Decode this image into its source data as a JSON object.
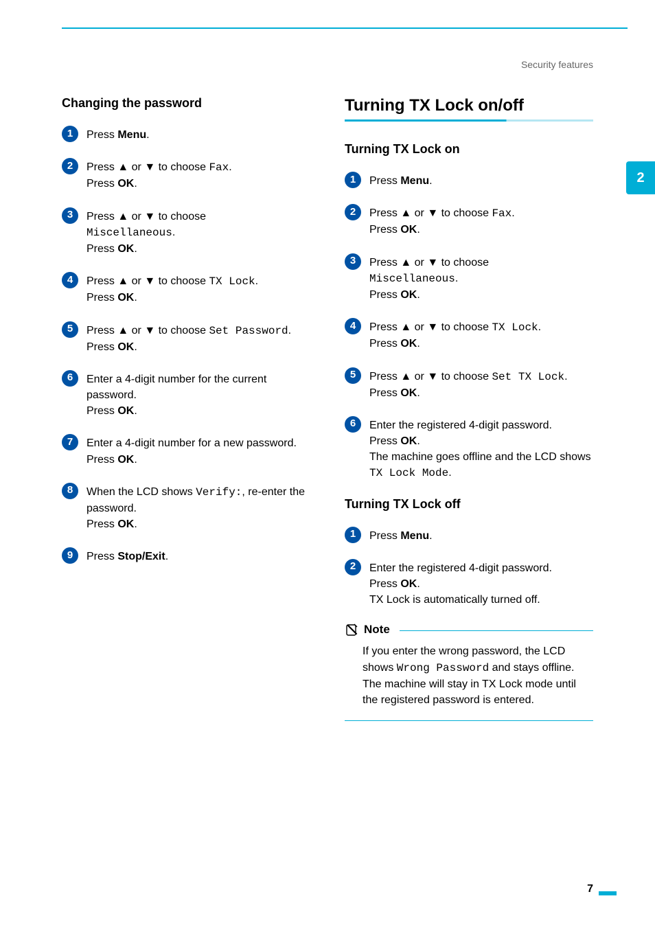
{
  "breadcrumb": "Security features",
  "page_tab": "2",
  "page_number": "7",
  "left": {
    "heading": "Changing the password",
    "steps": [
      {
        "n": "1",
        "color": "#0052a4",
        "parts": [
          {
            "t": "Press ",
            "b": false
          },
          {
            "t": "Menu",
            "b": true
          },
          {
            "t": ".",
            "b": false
          }
        ]
      },
      {
        "n": "2",
        "color": "#0052a4",
        "parts": [
          {
            "t": "Press ",
            "b": false
          },
          {
            "t": "a",
            "arrow": "up"
          },
          {
            "t": " or ",
            "b": false
          },
          {
            "t": "b",
            "arrow": "down"
          },
          {
            "t": " to choose ",
            "b": false
          },
          {
            "t": "Fax",
            "mono": true
          },
          {
            "t": ".",
            "b": false
          },
          {
            "br": true
          },
          {
            "t": "Press ",
            "b": false
          },
          {
            "t": "OK",
            "b": true
          },
          {
            "t": ".",
            "b": false
          }
        ]
      },
      {
        "n": "3",
        "color": "#0052a4",
        "parts": [
          {
            "t": "Press ",
            "b": false
          },
          {
            "t": "a",
            "arrow": "up"
          },
          {
            "t": " or ",
            "b": false
          },
          {
            "t": "b",
            "arrow": "down"
          },
          {
            "t": " to choose ",
            "b": false
          },
          {
            "br": true
          },
          {
            "t": "Miscellaneous",
            "mono": true
          },
          {
            "t": ".",
            "b": false
          },
          {
            "br": true
          },
          {
            "t": "Press ",
            "b": false
          },
          {
            "t": "OK",
            "b": true
          },
          {
            "t": ".",
            "b": false
          }
        ]
      },
      {
        "n": "4",
        "color": "#0052a4",
        "parts": [
          {
            "t": "Press ",
            "b": false
          },
          {
            "t": "a",
            "arrow": "up"
          },
          {
            "t": " or ",
            "b": false
          },
          {
            "t": "b",
            "arrow": "down"
          },
          {
            "t": " to choose ",
            "b": false
          },
          {
            "t": "TX Lock",
            "mono": true
          },
          {
            "t": ".",
            "b": false
          },
          {
            "br": true
          },
          {
            "t": "Press ",
            "b": false
          },
          {
            "t": "OK",
            "b": true
          },
          {
            "t": ".",
            "b": false
          }
        ]
      },
      {
        "n": "5",
        "color": "#0052a4",
        "parts": [
          {
            "t": "Press ",
            "b": false
          },
          {
            "t": "a",
            "arrow": "up"
          },
          {
            "t": " or ",
            "b": false
          },
          {
            "t": "b",
            "arrow": "down"
          },
          {
            "t": " to choose ",
            "b": false
          },
          {
            "t": "Set Password",
            "mono": true
          },
          {
            "t": ".",
            "b": false
          },
          {
            "br": true
          },
          {
            "t": "Press ",
            "b": false
          },
          {
            "t": "OK",
            "b": true
          },
          {
            "t": ".",
            "b": false
          }
        ]
      },
      {
        "n": "6",
        "color": "#0052a4",
        "parts": [
          {
            "t": "Enter a 4-digit number for the current password.",
            "b": false
          },
          {
            "br": true
          },
          {
            "t": "Press ",
            "b": false
          },
          {
            "t": "OK",
            "b": true
          },
          {
            "t": ".",
            "b": false
          }
        ]
      },
      {
        "n": "7",
        "color": "#0052a4",
        "parts": [
          {
            "t": "Enter a 4-digit number for a new password.",
            "b": false
          },
          {
            "br": true
          },
          {
            "t": "Press ",
            "b": false
          },
          {
            "t": "OK",
            "b": true
          },
          {
            "t": ".",
            "b": false
          }
        ]
      },
      {
        "n": "8",
        "color": "#0052a4",
        "parts": [
          {
            "t": "When the LCD shows ",
            "b": false
          },
          {
            "t": "Verify:",
            "mono": true
          },
          {
            "t": ", re-enter the password.",
            "b": false
          },
          {
            "br": true
          },
          {
            "t": "Press ",
            "b": false
          },
          {
            "t": "OK",
            "b": true
          },
          {
            "t": ".",
            "b": false
          }
        ]
      },
      {
        "n": "9",
        "color": "#0052a4",
        "parts": [
          {
            "t": "Press ",
            "b": false
          },
          {
            "t": "Stop/Exit",
            "b": true
          },
          {
            "t": ".",
            "b": false
          }
        ]
      }
    ]
  },
  "right": {
    "title": "Turning TX Lock on/off",
    "sectionA": {
      "heading": "Turning TX Lock on",
      "steps": [
        {
          "n": "1",
          "color": "#0052a4",
          "parts": [
            {
              "t": "Press ",
              "b": false
            },
            {
              "t": "Menu",
              "b": true
            },
            {
              "t": ".",
              "b": false
            }
          ]
        },
        {
          "n": "2",
          "color": "#0052a4",
          "parts": [
            {
              "t": "Press ",
              "b": false
            },
            {
              "t": "a",
              "arrow": "up"
            },
            {
              "t": " or ",
              "b": false
            },
            {
              "t": "b",
              "arrow": "down"
            },
            {
              "t": " to choose ",
              "b": false
            },
            {
              "t": "Fax",
              "mono": true
            },
            {
              "t": ".",
              "b": false
            },
            {
              "br": true
            },
            {
              "t": "Press ",
              "b": false
            },
            {
              "t": "OK",
              "b": true
            },
            {
              "t": ".",
              "b": false
            }
          ]
        },
        {
          "n": "3",
          "color": "#0052a4",
          "parts": [
            {
              "t": "Press ",
              "b": false
            },
            {
              "t": "a",
              "arrow": "up"
            },
            {
              "t": " or ",
              "b": false
            },
            {
              "t": "b",
              "arrow": "down"
            },
            {
              "t": " to choose ",
              "b": false
            },
            {
              "br": true
            },
            {
              "t": "Miscellaneous",
              "mono": true
            },
            {
              "t": ".",
              "b": false
            },
            {
              "br": true
            },
            {
              "t": "Press ",
              "b": false
            },
            {
              "t": "OK",
              "b": true
            },
            {
              "t": ".",
              "b": false
            }
          ]
        },
        {
          "n": "4",
          "color": "#0052a4",
          "parts": [
            {
              "t": "Press ",
              "b": false
            },
            {
              "t": "a",
              "arrow": "up"
            },
            {
              "t": " or ",
              "b": false
            },
            {
              "t": "b",
              "arrow": "down"
            },
            {
              "t": " to choose ",
              "b": false
            },
            {
              "t": "TX Lock",
              "mono": true
            },
            {
              "t": ".",
              "b": false
            },
            {
              "br": true
            },
            {
              "t": "Press ",
              "b": false
            },
            {
              "t": "OK",
              "b": true
            },
            {
              "t": ".",
              "b": false
            }
          ]
        },
        {
          "n": "5",
          "color": "#0052a4",
          "parts": [
            {
              "t": "Press ",
              "b": false
            },
            {
              "t": "a",
              "arrow": "up"
            },
            {
              "t": " or ",
              "b": false
            },
            {
              "t": "b",
              "arrow": "down"
            },
            {
              "t": " to choose ",
              "b": false
            },
            {
              "t": "Set TX Lock",
              "mono": true
            },
            {
              "t": ".",
              "b": false
            },
            {
              "br": true
            },
            {
              "t": "Press ",
              "b": false
            },
            {
              "t": "OK",
              "b": true
            },
            {
              "t": ".",
              "b": false
            }
          ]
        },
        {
          "n": "6",
          "color": "#0052a4",
          "parts": [
            {
              "t": "Enter the registered 4-digit password.",
              "b": false
            },
            {
              "br": true
            },
            {
              "t": "Press ",
              "b": false
            },
            {
              "t": "OK",
              "b": true
            },
            {
              "t": ".",
              "b": false
            },
            {
              "br": true
            },
            {
              "t": "The machine goes offline and the LCD shows ",
              "b": false
            },
            {
              "t": "TX Lock Mode",
              "mono": true
            },
            {
              "t": ".",
              "b": false
            }
          ]
        }
      ]
    },
    "sectionB": {
      "heading": "Turning TX Lock off",
      "steps": [
        {
          "n": "1",
          "color": "#0052a4",
          "parts": [
            {
              "t": "Press ",
              "b": false
            },
            {
              "t": "Menu",
              "b": true
            },
            {
              "t": ".",
              "b": false
            }
          ]
        },
        {
          "n": "2",
          "color": "#0052a4",
          "parts": [
            {
              "t": "Enter the registered 4-digit password.",
              "b": false
            },
            {
              "br": true
            },
            {
              "t": "Press ",
              "b": false
            },
            {
              "t": "OK",
              "b": true
            },
            {
              "t": ".",
              "b": false
            },
            {
              "br": true
            },
            {
              "t": "TX Lock is automatically turned off.",
              "b": false
            }
          ]
        }
      ]
    },
    "note": {
      "title": "Note",
      "body_parts": [
        {
          "t": "If you enter the wrong password, the LCD shows ",
          "b": false
        },
        {
          "t": "Wrong Password",
          "mono": true
        },
        {
          "t": " and stays offline. The machine will stay in TX Lock mode until the registered password is entered.",
          "b": false
        }
      ]
    }
  }
}
